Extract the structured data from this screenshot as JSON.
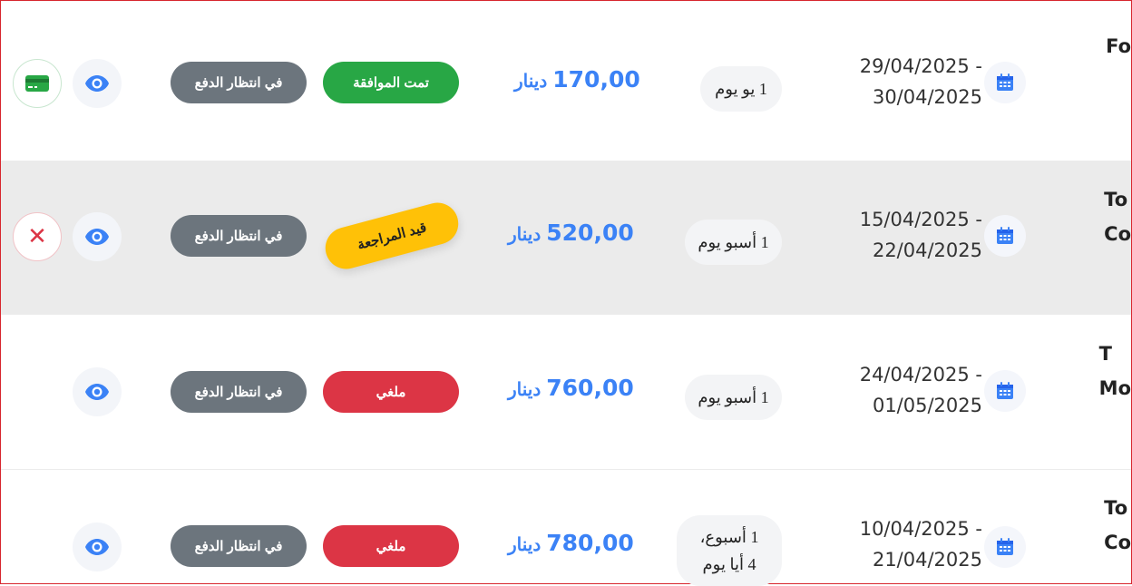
{
  "currency": "دينار",
  "rows": [
    {
      "name": "Fo",
      "date_from": "29/04/2025 -",
      "date_to": "30/04/2025",
      "duration": "1 يو يوم",
      "amount": "170,00",
      "status": "تمت الموافقة",
      "payment": "في انتظار الدفع",
      "action_icon": "credit-card-icon"
    },
    {
      "name": "To\nCo",
      "date_from": "15/04/2025 -",
      "date_to": "22/04/2025",
      "duration": "1 أسبو يوم",
      "amount": "520,00",
      "status": "قيد المراجعة",
      "payment": "في انتظار الدفع",
      "action_icon": "close-icon",
      "cancel_glyph": "✕"
    },
    {
      "name": "T\nMo",
      "date_from": "24/04/2025 -",
      "date_to": "01/05/2025",
      "duration": "1 أسبو يوم",
      "amount": "760,00",
      "status": "ملغي",
      "payment": "في انتظار الدفع"
    },
    {
      "name": "To\nCo",
      "date_from": "10/04/2025 -",
      "date_to": "21/04/2025",
      "duration_line1": "1 أسبوع،",
      "duration_line2": "4 أيا يوم",
      "amount": "780,00",
      "status": "ملغي",
      "payment": "في انتظار الدفع"
    }
  ],
  "colors": {
    "approved": "#28a745",
    "cancelled": "#dc3545",
    "pending_review": "#ffc107",
    "awaiting_payment": "#6c757d",
    "accent": "#3b82f6"
  },
  "icons": [
    "calendar-icon",
    "eye-icon",
    "credit-card-icon",
    "close-icon"
  ]
}
